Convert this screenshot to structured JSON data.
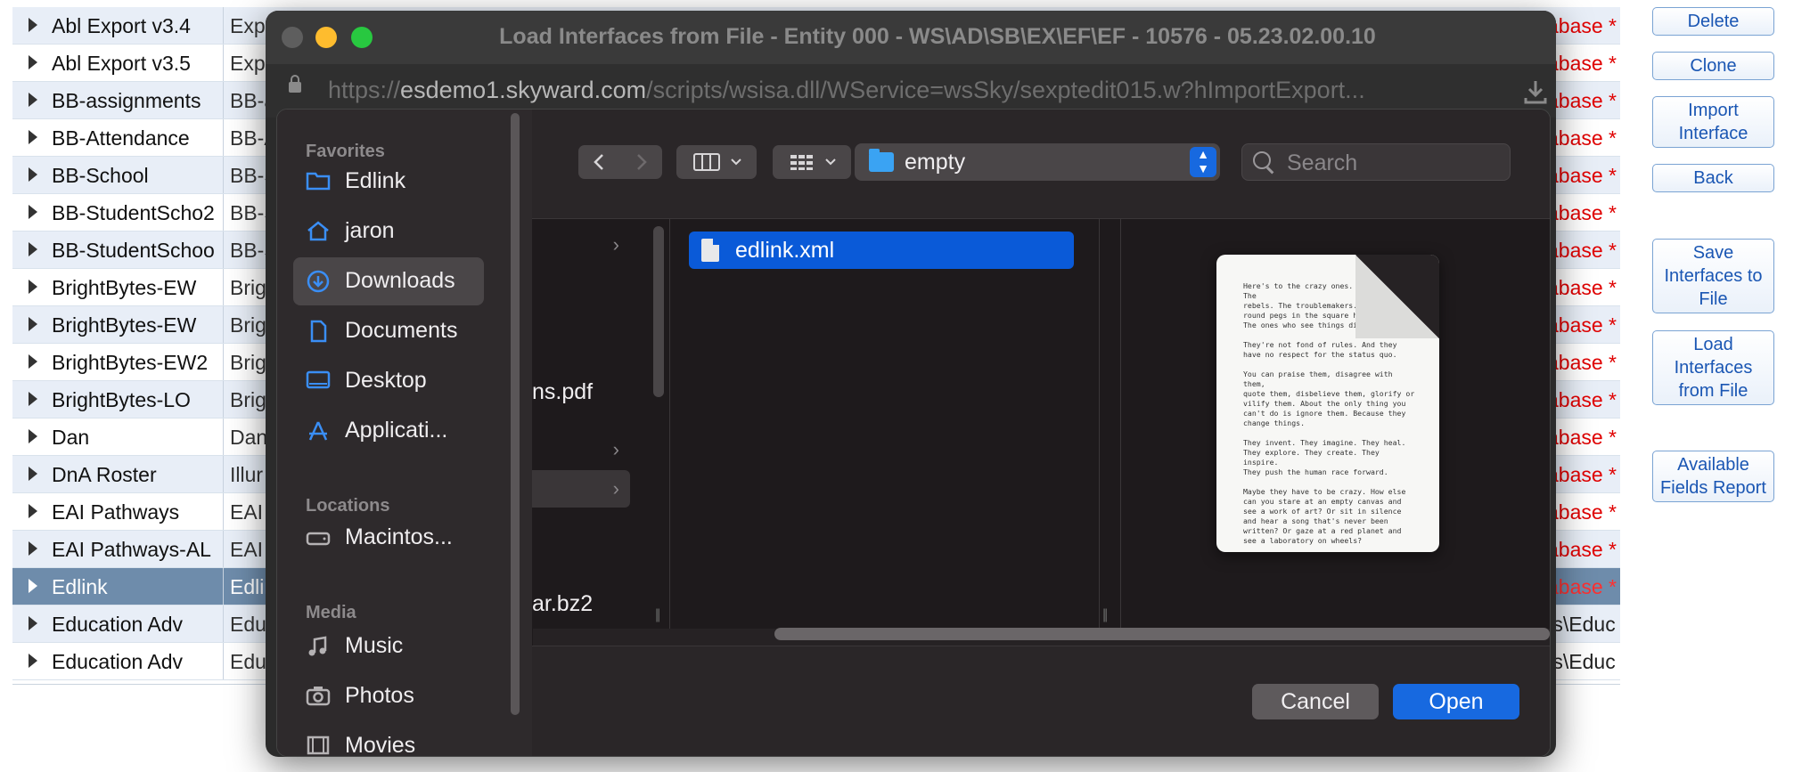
{
  "table": {
    "rows": [
      {
        "name": "Abl Export v3.4",
        "desc": "Expo",
        "status": "abase *"
      },
      {
        "name": "Abl Export v3.5",
        "desc": "Expo",
        "status": "abase *"
      },
      {
        "name": "BB-assignments",
        "desc": "BB-a",
        "status": "abase *"
      },
      {
        "name": "BB-Attendance",
        "desc": "BB-A",
        "status": "abase *"
      },
      {
        "name": "BB-School",
        "desc": "BB-S",
        "status": "abase *"
      },
      {
        "name": "BB-StudentScho2",
        "desc": "BB-S",
        "status": "abase *"
      },
      {
        "name": "BB-StudentSchoo",
        "desc": "BB-S",
        "status": "abase *"
      },
      {
        "name": "BrightBytes-EW",
        "desc": "Brig",
        "status": "abase *"
      },
      {
        "name": "BrightBytes-EW",
        "desc": "Brig",
        "status": "abase *"
      },
      {
        "name": "BrightBytes-EW2",
        "desc": "Brig",
        "status": "abase *"
      },
      {
        "name": "BrightBytes-LO",
        "desc": "Brig",
        "status": "abase *"
      },
      {
        "name": "Dan",
        "desc": "Dan",
        "status": "abase *"
      },
      {
        "name": "DnA Roster",
        "desc": "Illur",
        "status": "abase *"
      },
      {
        "name": "EAI Pathways",
        "desc": "EAI",
        "status": "abase *"
      },
      {
        "name": "EAI Pathways-AL",
        "desc": "EAI",
        "status": "abase *"
      },
      {
        "name": "Edlink",
        "desc": "Edlin",
        "status": "abase *"
      },
      {
        "name": "Education Adv",
        "desc": "Educ",
        "status": "ts\\Educ"
      },
      {
        "name": "Education Adv",
        "desc": "Educ",
        "status": "ts\\Educ"
      }
    ]
  },
  "side_buttons": {
    "delete": "Delete",
    "clone": "Clone",
    "import": "Import Interface",
    "back": "Back",
    "save": "Save Interfaces to File",
    "load": "Load Interfaces from File",
    "report": "Available Fields Report"
  },
  "window": {
    "title": "Load Interfaces from File - Entity 000 - WS\\AD\\SB\\EX\\EF\\EF - 10576 - 05.23.02.00.10",
    "url_prefix": "https://",
    "url_domain": "esdemo1.skyward.com",
    "url_path": "/scripts/wsisa.dll/WService=wsSky/sexptedit015.w?hImportExport..."
  },
  "picker": {
    "sidebar": {
      "favorites_heading": "Favorites",
      "favorites": [
        {
          "label": "Edlink",
          "icon": "folder-icon"
        },
        {
          "label": "jaron",
          "icon": "home-icon"
        },
        {
          "label": "Downloads",
          "icon": "downloads-icon"
        },
        {
          "label": "Documents",
          "icon": "document-icon"
        },
        {
          "label": "Desktop",
          "icon": "desktop-icon"
        },
        {
          "label": "Applicati...",
          "icon": "applications-icon"
        }
      ],
      "locations_heading": "Locations",
      "locations": [
        {
          "label": "Macintos...",
          "icon": "disk-icon"
        }
      ],
      "media_heading": "Media",
      "media": [
        {
          "label": "Music",
          "icon": "music-icon"
        },
        {
          "label": "Photos",
          "icon": "camera-icon"
        },
        {
          "label": "Movies",
          "icon": "film-icon"
        }
      ]
    },
    "path": "empty",
    "search_placeholder": "Search",
    "column1_items": [
      "ns.pdf",
      "ar.bz2"
    ],
    "selected_file": "edlink.xml",
    "preview_text": "Here's to the crazy ones. The misfits. The\nrebels. The troublemakers. The\nround pegs in the square holes.\nThe ones who see things differently.\n\nThey're not fond of rules. And they\nhave no respect for the status quo.\n\nYou can praise them, disagree with them,\nquote them, disbelieve them, glorify or\nvilify them. About the only thing you\ncan't do is ignore them. Because they\nchange things.\n\nThey invent. They imagine. They heal.\nThey explore. They create. They inspire.\nThey push the human race forward.\n\nMaybe they have to be crazy. How else\ncan you stare at an empty canvas and\nsee a work of art? Or sit in silence\nand hear a song that's never been\nwritten? Or gaze at a red planet and\nsee a laboratory on wheels?",
    "cancel_label": "Cancel",
    "open_label": "Open"
  },
  "colors": {
    "accent": "#1769e0",
    "status_red": "#e00000",
    "selected_row": "#6e8cab"
  }
}
